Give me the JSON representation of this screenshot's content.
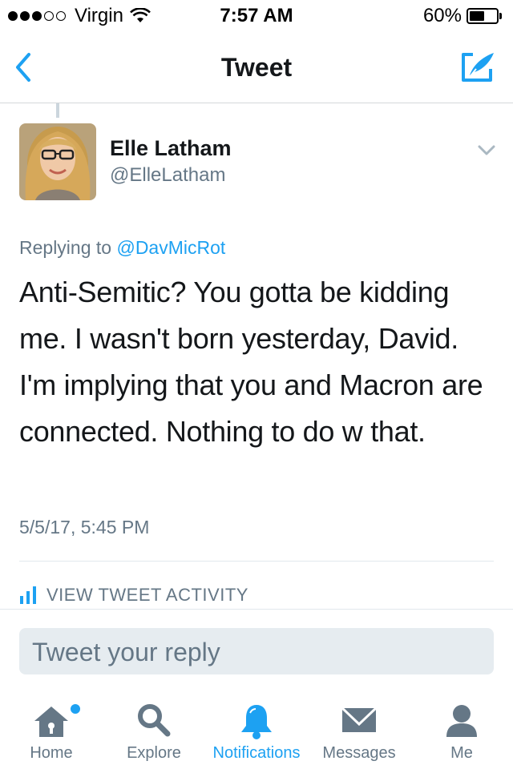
{
  "status_bar": {
    "carrier": "Virgin",
    "time": "7:57 AM",
    "battery_percent": "60%",
    "battery_level": 0.6,
    "signal_bars_filled": 3,
    "signal_bars_total": 5
  },
  "nav": {
    "title": "Tweet",
    "back_icon": "chevron-left-icon",
    "compose_icon": "compose-tweet-icon"
  },
  "tweet": {
    "author_name": "Elle Latham",
    "author_handle": "@ElleLatham",
    "replying_prefix": "Replying to ",
    "replying_to": "@DavMicRot",
    "text": "Anti-Semitic? You gotta be kidding me. I wasn't born yesterday, David. I'm implying that you and Macron are connected. Nothing to do w that.",
    "timestamp": "5/5/17, 5:45 PM",
    "activity_label": "VIEW TWEET ACTIVITY"
  },
  "reply": {
    "placeholder": "Tweet your reply"
  },
  "tabs": [
    {
      "label": "Home",
      "icon": "home-icon",
      "active": false
    },
    {
      "label": "Explore",
      "icon": "search-icon",
      "active": false
    },
    {
      "label": "Notifications",
      "icon": "bell-icon",
      "active": true
    },
    {
      "label": "Messages",
      "icon": "envelope-icon",
      "active": false
    },
    {
      "label": "Me",
      "icon": "person-icon",
      "active": false
    }
  ],
  "colors": {
    "accent": "#1da1f2",
    "text_primary": "#14171a",
    "text_secondary": "#657786",
    "divider": "#e1e8ed",
    "reply_bg": "#e6ecf0"
  }
}
